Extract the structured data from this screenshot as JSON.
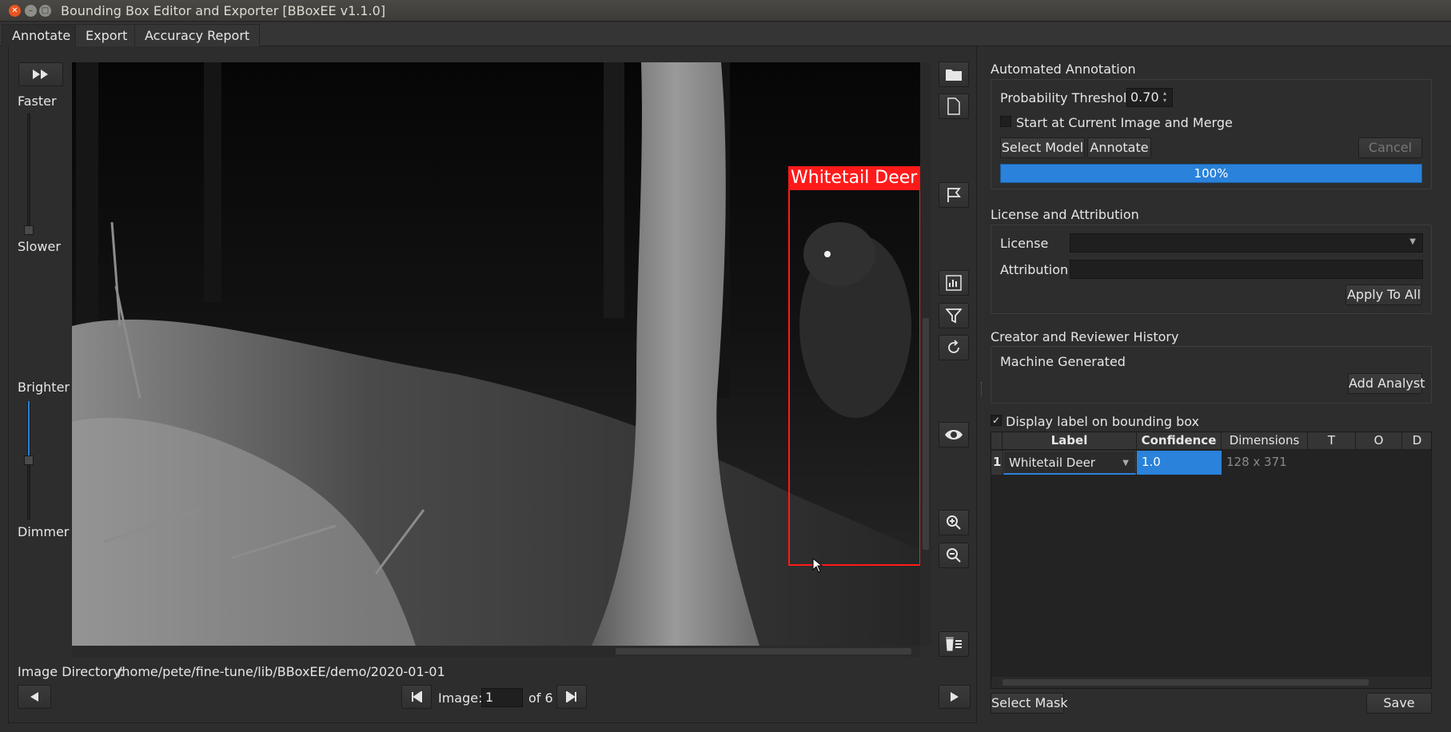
{
  "window": {
    "title": "Bounding Box Editor and Exporter [BBoxEE v1.1.0]"
  },
  "tabs": [
    {
      "label": "Annotate",
      "active": true
    },
    {
      "label": "Export",
      "active": false
    },
    {
      "label": "Accuracy Report",
      "active": false
    }
  ],
  "left_panel": {
    "faster_label": "Faster",
    "slower_label": "Slower",
    "speed_level": 0.0,
    "brighter_label": "Brighter",
    "dimmer_label": "Dimmer",
    "brightness_level": 0.5
  },
  "canvas": {
    "bbox_label": "Whitetail Deer",
    "bbox_color": "#ff1a1a"
  },
  "toolbar_icons": [
    "folder-icon",
    "file-icon",
    "flag-icon",
    "chart-icon",
    "filter-icon",
    "rotate-icon",
    "eye-icon",
    "zoom-in-icon",
    "zoom-out-icon",
    "delete-list-icon"
  ],
  "footer": {
    "directory_label": "Image Directory:",
    "directory_path": "/home/pete/fine-tune/lib/BBoxEE/demo/2020-01-01",
    "image_label": "Image:",
    "image_value": "1",
    "of_total": "of 6"
  },
  "automated_annotation": {
    "title": "Automated Annotation",
    "threshold_label": "Probability Threshold",
    "threshold_value": "0.70",
    "start_current_label": "Start at Current Image and Merge",
    "start_current_checked": false,
    "select_model_label": "Select Model",
    "annotate_label": "Annotate",
    "cancel_label": "Cancel",
    "progress_text": "100%",
    "progress": 1.0
  },
  "license": {
    "title": "License and Attribution",
    "license_label": "License",
    "license_value": "",
    "attribution_label": "Attribution",
    "attribution_value": "",
    "apply_all_label": "Apply To All"
  },
  "creator": {
    "title": "Creator and Reviewer History",
    "entry": "Machine Generated",
    "add_analyst_label": "Add Analyst"
  },
  "display_label": {
    "label": "Display label on bounding box",
    "checked": true,
    "check_glyph": "✓"
  },
  "table": {
    "headers": [
      "Label",
      "Confidence",
      "Dimensions",
      "T",
      "O",
      "D"
    ],
    "rows": [
      {
        "index": "1",
        "label": "Whitetail Deer",
        "confidence": "1.0",
        "dimensions": "128 x 371"
      }
    ]
  },
  "bottom_buttons": {
    "select_mask": "Select Mask",
    "save": "Save"
  },
  "colors": {
    "accent": "#2a82da",
    "background": "#2d2d2d"
  }
}
